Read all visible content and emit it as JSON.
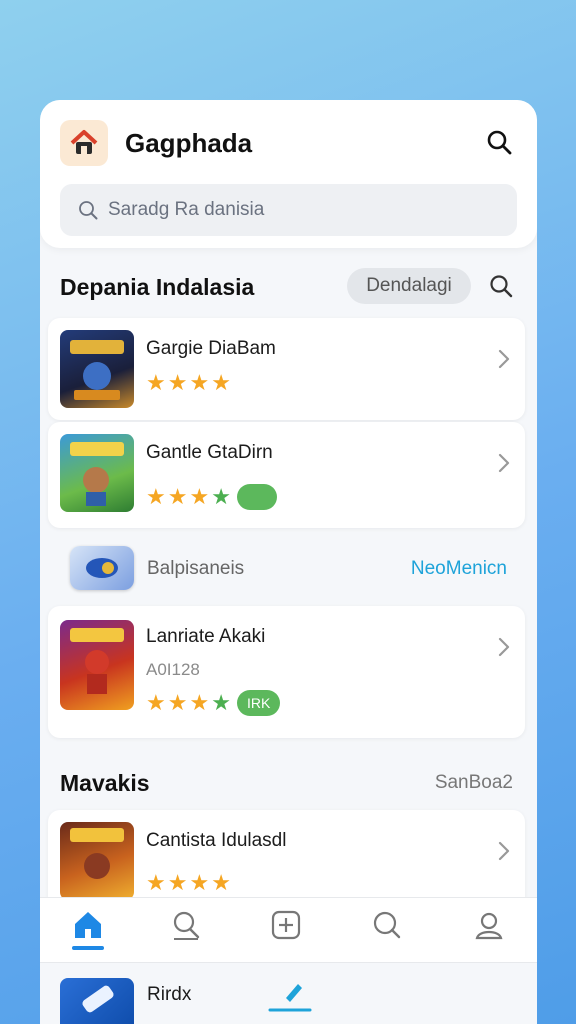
{
  "header": {
    "title": "Gagphada",
    "search_placeholder": "Saradg Ra danisia"
  },
  "section1": {
    "title": "Depania Indalasia",
    "pill_label": "Dendalagi"
  },
  "items": [
    {
      "name": "Gargie DiaBam",
      "rating": 4,
      "badge": ""
    },
    {
      "name": "Gantle GtaDirn",
      "rating": 4,
      "badge": ""
    },
    {
      "name": "Lanriate Akaki",
      "subtitle": "A0I128",
      "rating": 4,
      "badge": "IRK"
    }
  ],
  "mid_row": {
    "label": "Balpisaneis",
    "link": "NeoMenicn"
  },
  "section2": {
    "title": "Mavakis",
    "see_all": "SanBoa2"
  },
  "section2_items": [
    {
      "name": "Cantista Idulasdl",
      "rating": 4
    }
  ],
  "tabs": [
    {
      "icon": "home-icon",
      "active": true
    },
    {
      "icon": "search-icon",
      "active": false
    },
    {
      "icon": "add-icon",
      "active": false
    },
    {
      "icon": "search-alt-icon",
      "active": false
    },
    {
      "icon": "profile-icon",
      "active": false
    }
  ],
  "bottom_row": {
    "name": "Rirdx"
  },
  "colors": {
    "accent": "#1e88e5",
    "link": "#1ea3d9",
    "star": "#f5a623",
    "badge_green": "#5cb85c"
  }
}
